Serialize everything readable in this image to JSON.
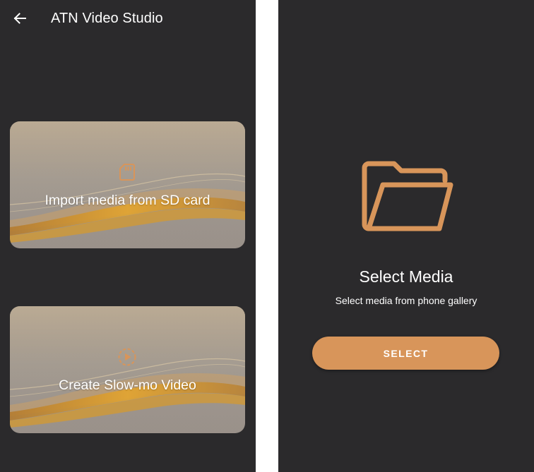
{
  "left_screen": {
    "appbar": {
      "back_icon": "arrow-left-icon",
      "title": "ATN Video Studio"
    },
    "cards": [
      {
        "icon": "sd-card-icon",
        "label": "Import media from SD card"
      },
      {
        "icon": "slow-motion-play-icon",
        "label": "Create Slow-mo Video"
      }
    ]
  },
  "right_screen": {
    "icon": "folder-open-icon",
    "title": "Select Media",
    "subtitle": "Select media from phone gallery",
    "button_label": "SELECT"
  },
  "colors": {
    "background": "#2b2a2c",
    "accent": "#d8955a",
    "text": "#ffffff"
  }
}
